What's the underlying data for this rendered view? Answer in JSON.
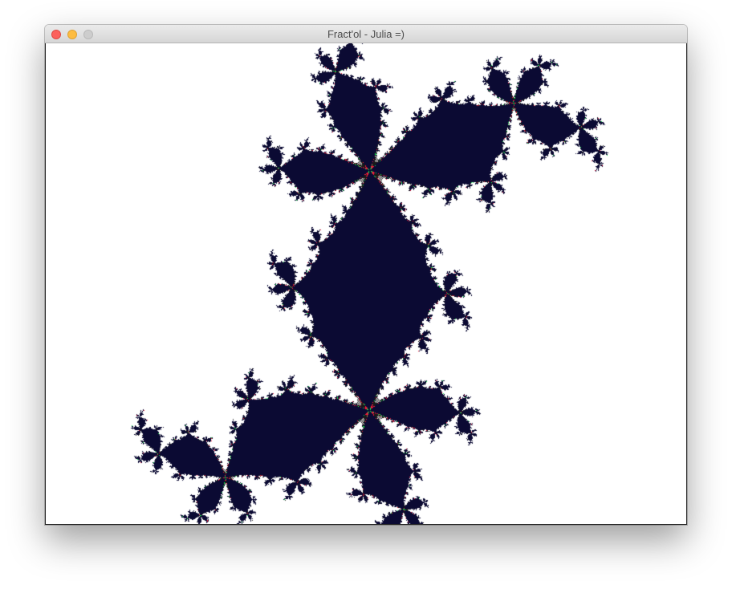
{
  "window": {
    "title": "Fract'ol - Julia =)",
    "controls": {
      "close_color": "#fc605c",
      "minimize_color": "#fdbc40",
      "zoom_color": "#cdcdcd"
    }
  },
  "fractal": {
    "type": "julia",
    "colors": {
      "interior": "#0b0a33",
      "band_green": "#14f04a",
      "band_red": "#f41a3a",
      "edge_dark": "#1a1a1a",
      "background": "#ffffff"
    }
  }
}
